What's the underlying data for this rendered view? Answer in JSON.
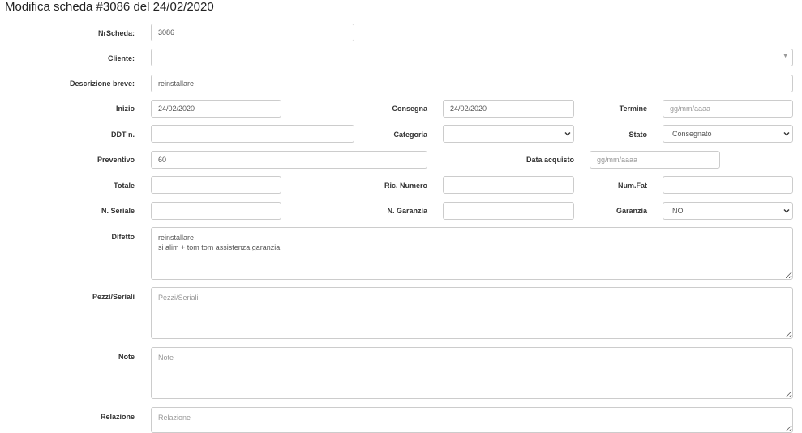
{
  "page": {
    "title": "Modifica scheda #3086 del 24/02/2020"
  },
  "form": {
    "nrscheda": {
      "label": "NrScheda:",
      "value": "3086"
    },
    "cliente": {
      "label": "Cliente:",
      "value": ""
    },
    "descrizione": {
      "label": "Descrizione breve:",
      "value": "reinstallare"
    },
    "inizio": {
      "label": "Inizio",
      "value": "24/02/2020"
    },
    "consegna": {
      "label": "Consegna",
      "value": "24/02/2020"
    },
    "termine": {
      "label": "Termine",
      "placeholder": "gg/mm/aaaa",
      "value": ""
    },
    "ddt": {
      "label": "DDT n.",
      "value": ""
    },
    "categoria": {
      "label": "Categoria",
      "value": ""
    },
    "stato": {
      "label": "Stato",
      "value": "Consegnato"
    },
    "preventivo": {
      "label": "Preventivo",
      "value": "60"
    },
    "data_acquisto": {
      "label": "Data acquisto",
      "placeholder": "gg/mm/aaaa",
      "value": ""
    },
    "totale": {
      "label": "Totale",
      "value": ""
    },
    "ric_numero": {
      "label": "Ric. Numero",
      "value": ""
    },
    "num_fat": {
      "label": "Num.Fat",
      "value": ""
    },
    "n_seriale": {
      "label": "N. Seriale",
      "value": ""
    },
    "n_garanzia": {
      "label": "N. Garanzia",
      "value": ""
    },
    "garanzia": {
      "label": "Garanzia",
      "value": "NO"
    },
    "difetto": {
      "label": "Difetto",
      "value": "reinstallare\nsi alim + tom tom assistenza garanzia"
    },
    "pezzi": {
      "label": "Pezzi/Seriali",
      "placeholder": "Pezzi/Seriali",
      "value": ""
    },
    "note": {
      "label": "Note",
      "placeholder": "Note",
      "value": ""
    },
    "relazione": {
      "label": "Relazione",
      "placeholder": "Relazione",
      "value": ""
    }
  },
  "icons": {
    "cliente_caret": "triangle-down-icon",
    "select_caret": "chevron-down-icon"
  }
}
